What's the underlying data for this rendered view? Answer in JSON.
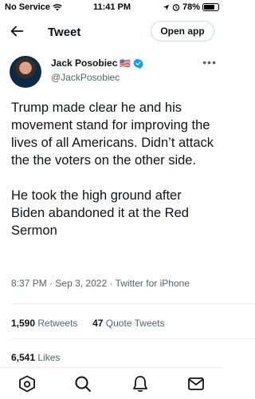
{
  "status_bar": {
    "carrier": "No Service",
    "time": "11:41 PM",
    "battery": "78%",
    "battery_level": 0.78
  },
  "header": {
    "title": "Tweet",
    "open_app": "Open app"
  },
  "author": {
    "name": "Jack Posobiec",
    "handle": "@JackPosobiec",
    "flag": "🇺🇸"
  },
  "tweet": {
    "paragraph_1": "Trump made clear he and his movement stand for improving the lives of all Americans. Didn’t attack the the voters on the other side.",
    "paragraph_2": "He took the high ground after Biden abandoned it at the Red Sermon"
  },
  "meta": {
    "time": "8:37 PM",
    "date": "Sep 3, 2022",
    "source": "Twitter for iPhone"
  },
  "stats": {
    "retweets_count": "1,590",
    "retweets_label": "Retweets",
    "quotes_count": "47",
    "quotes_label": "Quote Tweets",
    "likes_count": "6,541",
    "likes_label": "Likes"
  },
  "colors": {
    "verified": "#1d9bf0",
    "text": "#0f1419",
    "secondary": "#536471"
  },
  "icons": [
    "back-arrow-icon",
    "more-icon",
    "verified-icon",
    "home-icon",
    "search-icon",
    "notifications-icon",
    "messages-icon"
  ]
}
